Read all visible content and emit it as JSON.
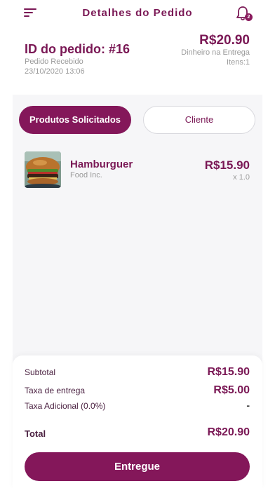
{
  "header": {
    "title": "Detalhes do Pedido",
    "notification_count": "2"
  },
  "order": {
    "id_label": "ID do pedido: #16",
    "status": "Pedido Recebido",
    "date": "23/10/2020 13:06",
    "total": "R$20.90",
    "payment_method": "Dinheiro na Entrega",
    "items_count": "Itens:1"
  },
  "tabs": [
    {
      "label": "Produtos Solicitados",
      "active": true
    },
    {
      "label": "Cliente",
      "active": false
    }
  ],
  "products": [
    {
      "name": "Hamburguer",
      "vendor": "Food Inc.",
      "price": "R$15.90",
      "quantity": "x 1.0",
      "image": "burger-photo"
    }
  ],
  "totals": {
    "subtotal_label": "Subtotal",
    "subtotal_value": "R$15.90",
    "delivery_label": "Taxa de entrega",
    "delivery_value": "R$5.00",
    "extra_label": "Taxa Adicional (0.0%)",
    "extra_value": "-",
    "total_label": "Total",
    "total_value": "R$20.90"
  },
  "action": {
    "deliver_label": "Entregue"
  },
  "colors": {
    "primary": "#84175a",
    "background": "#f6f6f8",
    "muted_text": "#9a9a9a"
  }
}
